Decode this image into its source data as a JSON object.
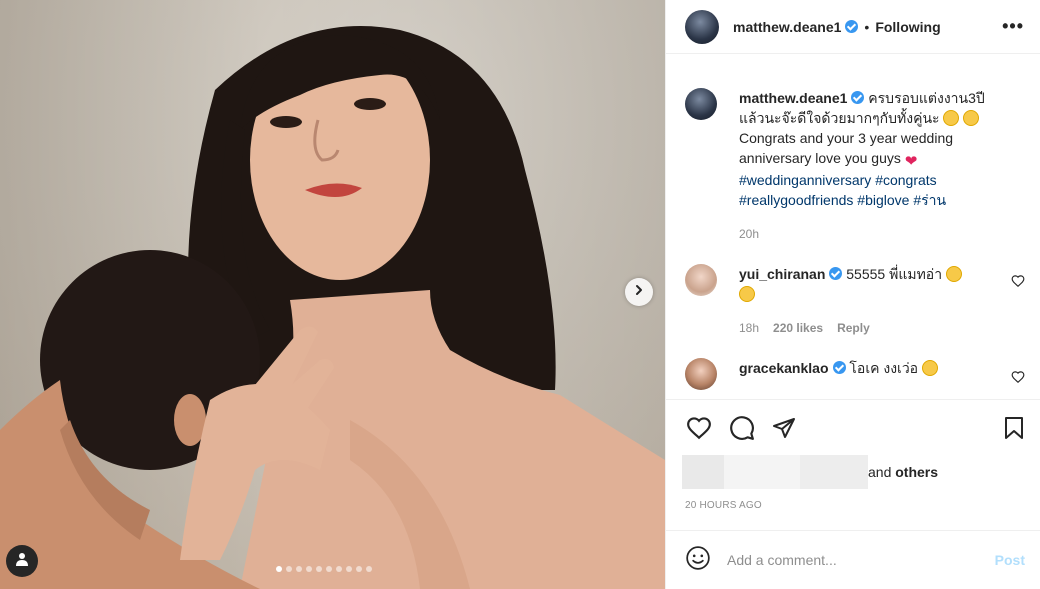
{
  "post": {
    "media": {
      "alt_description": "",
      "carousel_total": 10,
      "carousel_active": 1
    },
    "header": {
      "username": "matthew.deane1",
      "separator": "•",
      "follow_status": "Following",
      "more_label": "•••"
    },
    "caption": {
      "username": "matthew.deane1",
      "line1": "ครบรอบแต่งงาน3ปี",
      "line2": "แล้วนะจ๊ะดีใจด้วยมากๆกับทั้งคู่นะ",
      "line3": "Congrats and your 3 year wedding",
      "line4": "anniversary love you guys",
      "hashtags_line1": "#weddinganniversary #congrats",
      "hashtags_line2": "#reallygoodfriends #biglove #ร่าน",
      "time": "20h"
    },
    "comments": [
      {
        "username": "yui_chiranan",
        "text": "55555 พี่แมทอ่า",
        "time": "18h",
        "likes": "220 likes",
        "reply": "Reply"
      },
      {
        "username": "gracekanklao",
        "text": "โอเค งงเว่อ",
        "time": "",
        "likes": "",
        "reply": ""
      }
    ],
    "likes_suffix": "and",
    "likes_others": "others",
    "timestamp": "20 HOURS AGO",
    "comment_box": {
      "placeholder": "Add a comment...",
      "post_label": "Post"
    }
  },
  "colors": {
    "link": "#00376b",
    "verified": "#3897f0",
    "post_disabled": "#b2dffc",
    "muted": "#8e8e8e"
  }
}
